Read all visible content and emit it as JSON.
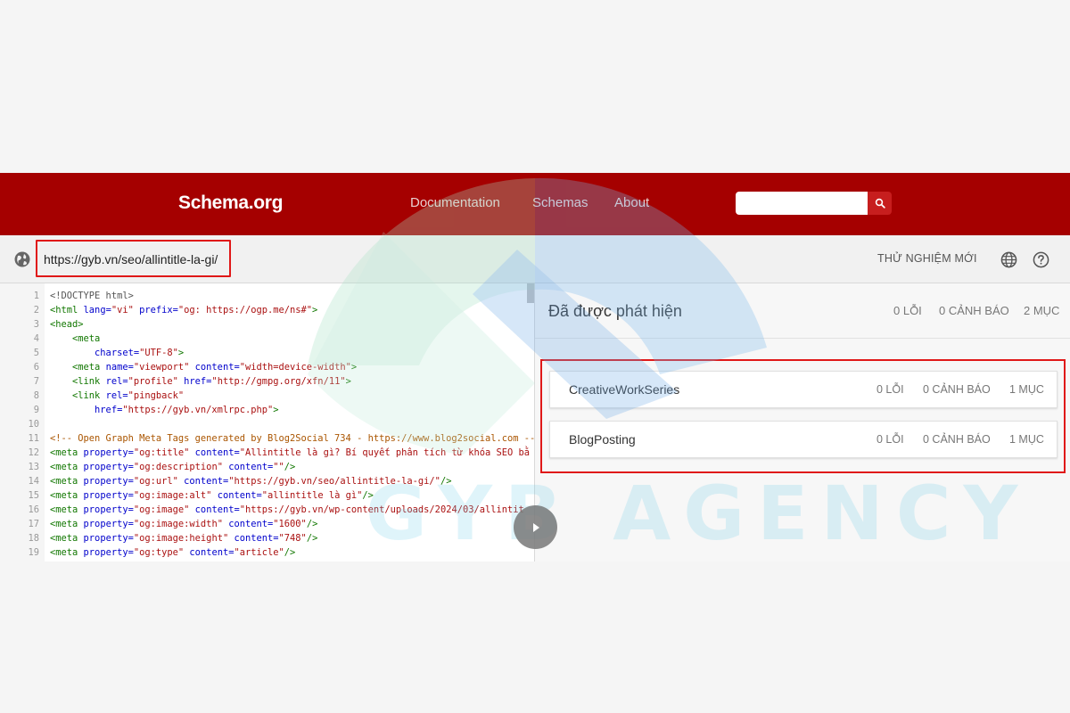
{
  "header": {
    "logo": "Schema.org",
    "nav": [
      "Documentation",
      "Schemas",
      "About"
    ],
    "search_placeholder": "",
    "colors": {
      "brand": "#a50000",
      "search_button": "#c71e1e"
    }
  },
  "toolbar": {
    "url": "https://gyb.vn/seo/allintitle-la-gi/",
    "new_test": "THỬ NGHIỆM MỚI",
    "icons": [
      "globe-icon",
      "language-icon",
      "help-icon"
    ]
  },
  "code": {
    "lines": [
      [
        {
          "c": "t-plain",
          "t": "<!DOCTYPE html>"
        }
      ],
      [
        {
          "c": "t-tag",
          "t": "<html "
        },
        {
          "c": "t-attr",
          "t": "lang="
        },
        {
          "c": "t-str",
          "t": "\"vi\""
        },
        {
          "c": "t-attr",
          "t": " prefix="
        },
        {
          "c": "t-str",
          "t": "\"og: https://ogp.me/ns#\""
        },
        {
          "c": "t-tag",
          "t": ">"
        }
      ],
      [
        {
          "c": "t-tag",
          "t": "<head>"
        }
      ],
      [
        {
          "c": "t-tag",
          "t": "    <meta"
        }
      ],
      [
        {
          "c": "t-attr",
          "t": "        charset="
        },
        {
          "c": "t-str",
          "t": "\"UTF-8\""
        },
        {
          "c": "t-tag",
          "t": ">"
        }
      ],
      [
        {
          "c": "t-tag",
          "t": "    <meta "
        },
        {
          "c": "t-attr",
          "t": "name="
        },
        {
          "c": "t-str",
          "t": "\"viewport\""
        },
        {
          "c": "t-attr",
          "t": " content="
        },
        {
          "c": "t-str",
          "t": "\"width=device-width\""
        },
        {
          "c": "t-tag",
          "t": ">"
        }
      ],
      [
        {
          "c": "t-tag",
          "t": "    <link "
        },
        {
          "c": "t-attr",
          "t": "rel="
        },
        {
          "c": "t-str",
          "t": "\"profile\""
        },
        {
          "c": "t-attr",
          "t": " href="
        },
        {
          "c": "t-str",
          "t": "\"http://gmpg.org/xfn/11\""
        },
        {
          "c": "t-tag",
          "t": ">"
        }
      ],
      [
        {
          "c": "t-tag",
          "t": "    <link "
        },
        {
          "c": "t-attr",
          "t": "rel="
        },
        {
          "c": "t-str",
          "t": "\"pingback\""
        }
      ],
      [
        {
          "c": "t-attr",
          "t": "        href="
        },
        {
          "c": "t-str",
          "t": "\"https://gyb.vn/xmlrpc.php\""
        },
        {
          "c": "t-tag",
          "t": ">"
        }
      ],
      [
        {
          "c": "t-plain",
          "t": ""
        }
      ],
      [
        {
          "c": "t-cmt",
          "t": "<!-- Open Graph Meta Tags generated by Blog2Social 734 - https://www.blog2social.com --"
        }
      ],
      [
        {
          "c": "t-tag",
          "t": "<meta "
        },
        {
          "c": "t-attr",
          "t": "property="
        },
        {
          "c": "t-str",
          "t": "\"og:title\""
        },
        {
          "c": "t-attr",
          "t": " content="
        },
        {
          "c": "t-str",
          "t": "\"Allintitle là gì? Bí quyết phân tích từ khóa SEO bằ"
        }
      ],
      [
        {
          "c": "t-tag",
          "t": "<meta "
        },
        {
          "c": "t-attr",
          "t": "property="
        },
        {
          "c": "t-str",
          "t": "\"og:description\""
        },
        {
          "c": "t-attr",
          "t": " content="
        },
        {
          "c": "t-str",
          "t": "\"\""
        },
        {
          "c": "t-tag",
          "t": "/>"
        }
      ],
      [
        {
          "c": "t-tag",
          "t": "<meta "
        },
        {
          "c": "t-attr",
          "t": "property="
        },
        {
          "c": "t-str",
          "t": "\"og:url\""
        },
        {
          "c": "t-attr",
          "t": " content="
        },
        {
          "c": "t-str",
          "t": "\"https://gyb.vn/seo/allintitle-la-gi/\""
        },
        {
          "c": "t-tag",
          "t": "/>"
        }
      ],
      [
        {
          "c": "t-tag",
          "t": "<meta "
        },
        {
          "c": "t-attr",
          "t": "property="
        },
        {
          "c": "t-str",
          "t": "\"og:image:alt\""
        },
        {
          "c": "t-attr",
          "t": " content="
        },
        {
          "c": "t-str",
          "t": "\"allintitle là gì\""
        },
        {
          "c": "t-tag",
          "t": "/>"
        }
      ],
      [
        {
          "c": "t-tag",
          "t": "<meta "
        },
        {
          "c": "t-attr",
          "t": "property="
        },
        {
          "c": "t-str",
          "t": "\"og:image\""
        },
        {
          "c": "t-attr",
          "t": " content="
        },
        {
          "c": "t-str",
          "t": "\"https://gyb.vn/wp-content/uploads/2024/03/allintit"
        }
      ],
      [
        {
          "c": "t-tag",
          "t": "<meta "
        },
        {
          "c": "t-attr",
          "t": "property="
        },
        {
          "c": "t-str",
          "t": "\"og:image:width\""
        },
        {
          "c": "t-attr",
          "t": " content="
        },
        {
          "c": "t-str",
          "t": "\"1600\""
        },
        {
          "c": "t-tag",
          "t": "/>"
        }
      ],
      [
        {
          "c": "t-tag",
          "t": "<meta "
        },
        {
          "c": "t-attr",
          "t": "property="
        },
        {
          "c": "t-str",
          "t": "\"og:image:height\""
        },
        {
          "c": "t-attr",
          "t": " content="
        },
        {
          "c": "t-str",
          "t": "\"748\""
        },
        {
          "c": "t-tag",
          "t": "/>"
        }
      ],
      [
        {
          "c": "t-tag",
          "t": "<meta "
        },
        {
          "c": "t-attr",
          "t": "property="
        },
        {
          "c": "t-str",
          "t": "\"og:type\""
        },
        {
          "c": "t-attr",
          "t": " content="
        },
        {
          "c": "t-str",
          "t": "\"article\""
        },
        {
          "c": "t-tag",
          "t": "/>"
        }
      ]
    ]
  },
  "results": {
    "title": "Đã được phát hiện",
    "errors": "0 LỖI",
    "warnings": "0 CẢNH BÁO",
    "items": "2 MỤC",
    "schemas": [
      {
        "name": "CreativeWorkSeries",
        "errors": "0 LỖI",
        "warnings": "0 CẢNH BÁO",
        "items": "1 MỤC"
      },
      {
        "name": "BlogPosting",
        "errors": "0 LỖI",
        "warnings": "0 CẢNH BÁO",
        "items": "1 MỤC"
      }
    ]
  },
  "watermark": {
    "text": "GYB AGENCY"
  }
}
